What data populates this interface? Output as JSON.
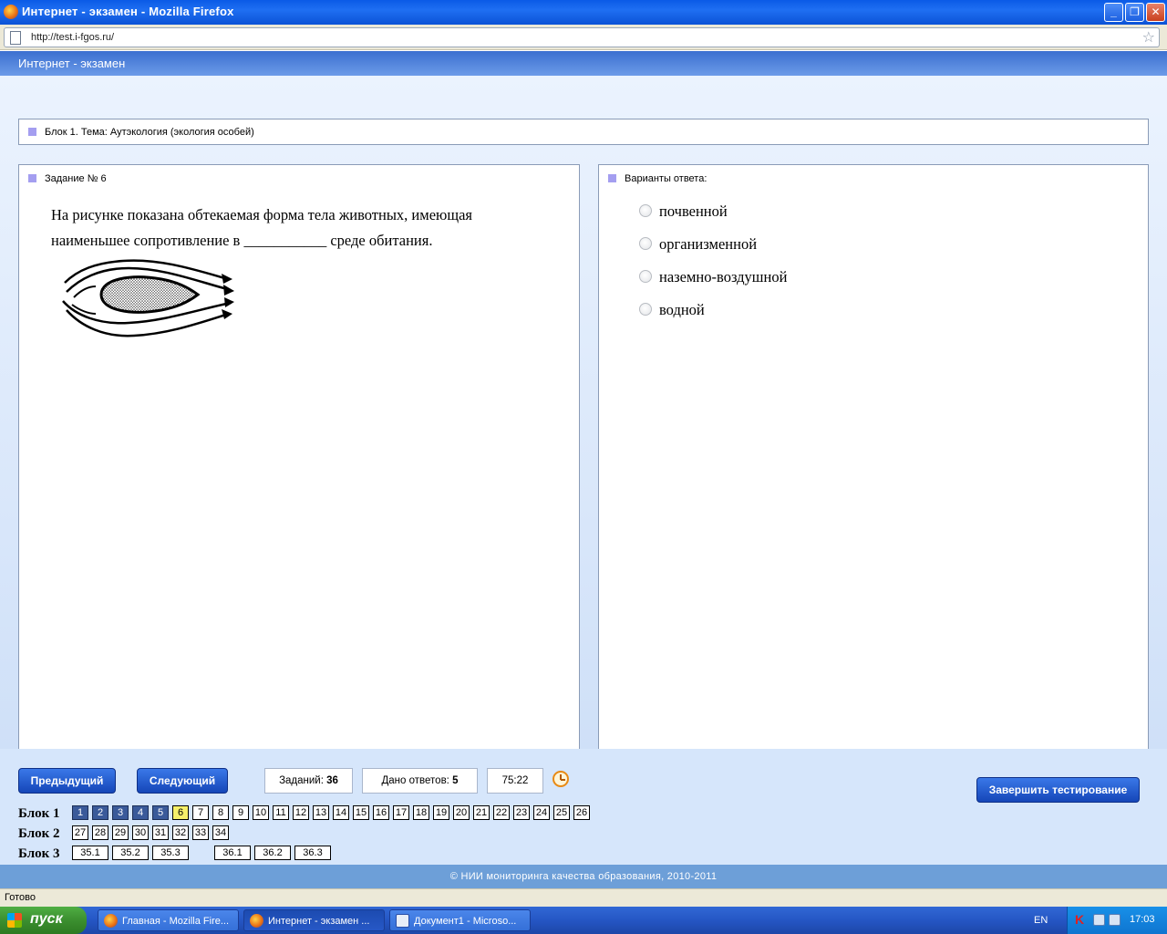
{
  "window": {
    "title": "Интернет - экзамен - Mozilla Firefox",
    "minimize": "_",
    "maximize": "❐",
    "close": "✕"
  },
  "browser": {
    "url": "http://test.i-fgos.ru/",
    "status": "Готово"
  },
  "page": {
    "header": "Интернет - экзамен",
    "block_title": "Блок 1. Тема: Аутэкология (экология особей)",
    "task": {
      "header": "Задание № 6",
      "text": "На рисунке показана обтекаемая форма тела животных, имеющая наименьшее сопротивление в ___________ среде обитания."
    },
    "answers": {
      "header": "Варианты ответа:",
      "options": [
        "почвенной",
        "организменной",
        "наземно-воздушной",
        "водной"
      ]
    },
    "controls": {
      "prev": "Предыдущий",
      "next": "Следующий",
      "tasks_label": "Заданий:",
      "tasks_value": "36",
      "answered_label": "Дано ответов:",
      "answered_value": "5",
      "timer": "75:22",
      "finish": "Завершить тестирование"
    },
    "navigation": {
      "block1_label": "Блок 1",
      "block1": [
        "1",
        "2",
        "3",
        "4",
        "5",
        "6",
        "7",
        "8",
        "9",
        "10",
        "11",
        "12",
        "13",
        "14",
        "15",
        "16",
        "17",
        "18",
        "19",
        "20",
        "21",
        "22",
        "23",
        "24",
        "25",
        "26"
      ],
      "block1_answered": [
        "1",
        "2",
        "3",
        "4",
        "5"
      ],
      "block1_current": "6",
      "block2_label": "Блок 2",
      "block2": [
        "27",
        "28",
        "29",
        "30",
        "31",
        "32",
        "33",
        "34"
      ],
      "block3_label": "Блок 3",
      "block3_group1": [
        "35.1",
        "35.2",
        "35.3"
      ],
      "block3_group2": [
        "36.1",
        "36.2",
        "36.3"
      ]
    },
    "footer": "© НИИ мониторинга качества образования, 2010-2011"
  },
  "taskbar": {
    "start": "пуск",
    "items": [
      "Главная - Mozilla Fire...",
      "Интернет - экзамен ...",
      "Документ1 - Microso..."
    ],
    "lang": "EN",
    "time": "17:03"
  },
  "icons": {
    "app": "firefox-icon",
    "page": "page-icon",
    "bookmark": "star-icon",
    "timer": "alarm-clock-icon"
  }
}
